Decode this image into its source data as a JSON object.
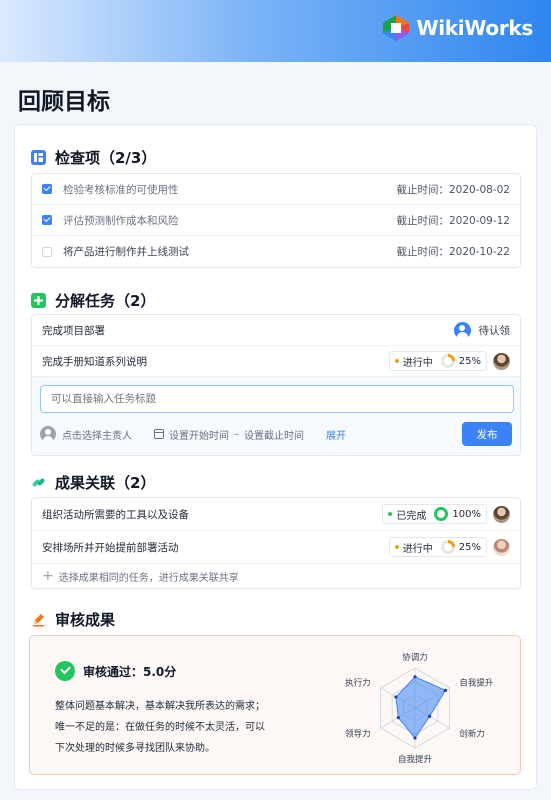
{
  "brand": {
    "name": "WikiWorks"
  },
  "page": {
    "title": "回顾目标"
  },
  "checklist": {
    "title": "检查项（2/3）",
    "items": [
      {
        "text": "检验考核标准的可使用性",
        "checked": true,
        "deadline": "截止时间：2020-08-02"
      },
      {
        "text": "评估预测制作成本和风险",
        "checked": true,
        "deadline": "截止时间：2020-09-12"
      },
      {
        "text": "将产品进行制作并上线测试",
        "checked": false,
        "deadline": "截止时间：2020-10-22"
      }
    ]
  },
  "tasks": {
    "title": "分解任务（2）",
    "items": [
      {
        "name": "完成项目部署",
        "assignee_status": "待认领"
      },
      {
        "name": "完成手册知道系列说明",
        "status": "进行中",
        "progress": "25%"
      }
    ],
    "compose": {
      "placeholder": "可以直接输入任务标题",
      "assignee_label": "点击选择主责人",
      "start_label": "设置开始时间",
      "separator": "–",
      "end_label": "设置截止时间",
      "expand_label": "展开",
      "publish_label": "发布"
    }
  },
  "results": {
    "title": "成果关联（2）",
    "items": [
      {
        "name": "组织活动所需要的工具以及设备",
        "status": "已完成",
        "progress": "100%"
      },
      {
        "name": "安排场所并开始提前部署活动",
        "status": "进行中",
        "progress": "25%"
      }
    ],
    "add_label": "选择成果相同的任务，进行成果关联共享"
  },
  "review": {
    "title": "审核成果",
    "result": "审核通过：5.0分",
    "comment_lines": [
      "整体问题基本解决，基本解决我所表达的需求；",
      "唯一不足的是：在做任务的时候不太灵活，可以",
      "下次处理的时候多寻找团队来协助。"
    ],
    "radar": {
      "axes": [
        "协调力",
        "自我提升",
        "创新力",
        "自我提升",
        "领导力",
        "执行力"
      ],
      "values": [
        0.78,
        0.88,
        0.42,
        0.75,
        0.48,
        0.55
      ],
      "color": "#3b82f6"
    }
  },
  "colors": {
    "accent": "#3b82f6",
    "green": "#22c55e",
    "orange": "#f59e0b"
  }
}
